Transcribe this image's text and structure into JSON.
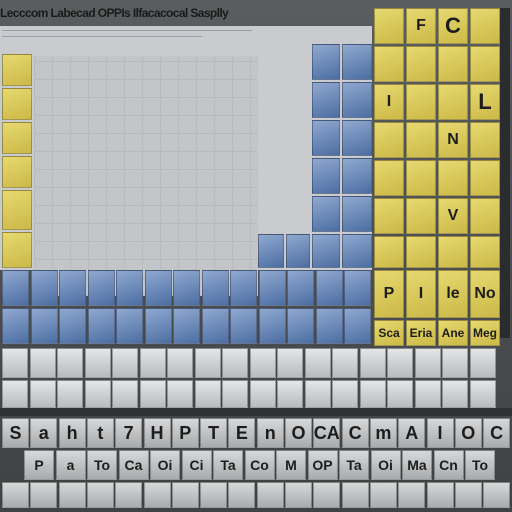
{
  "title": "Lecccom Labecad OPPIs Ilfacacocal Sasplly",
  "groups": {
    "right_top": [
      "F",
      "C",
      "I",
      "L",
      "N",
      "V",
      "I",
      "P",
      "le",
      "No"
    ],
    "right_bottom": [
      "Sca",
      "Eria",
      "Ane",
      "Meg"
    ],
    "row_1": [
      "S",
      "a",
      "h",
      "t",
      "7",
      "H",
      "P",
      "T",
      "E",
      "n",
      "O",
      "CA",
      "C",
      "m",
      "A",
      "I",
      "O",
      "C"
    ],
    "row_2": [
      "P",
      "a",
      "To",
      "Ca",
      "Oi",
      "Ci",
      "Ta",
      "Co",
      "M",
      "OP",
      "Ta",
      "Oi",
      "Ma",
      "Cn",
      "To"
    ]
  },
  "colors": {
    "yellow": "#dccb5d",
    "blue": "#5d7fb3",
    "gray": "#cfd1d3",
    "dark": "#3f4143"
  }
}
